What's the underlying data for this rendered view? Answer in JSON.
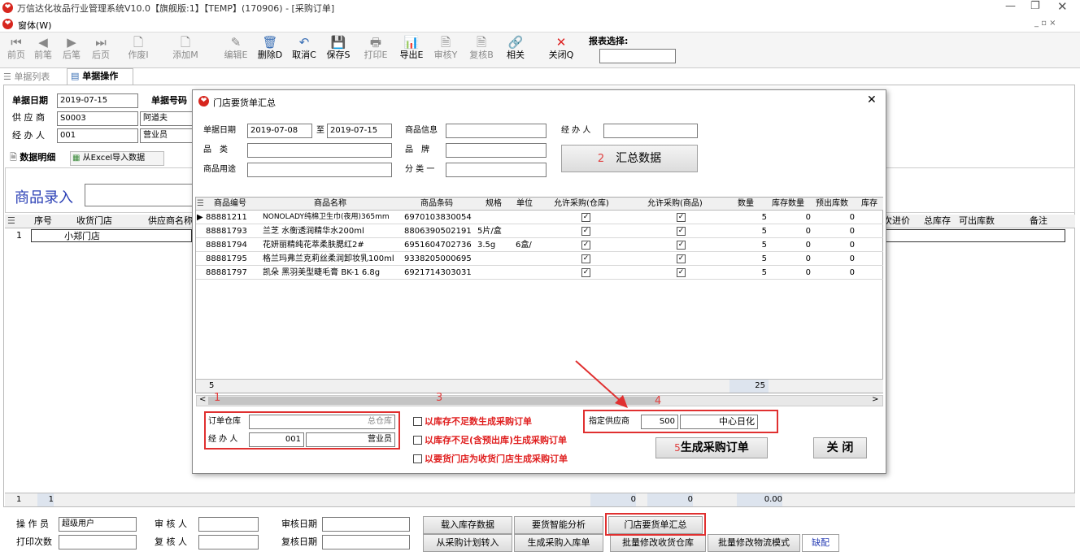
{
  "window": {
    "title": "万信达化妆品行业管理系统V10.0【旗舰版:1】【TEMP】(170906) - [采购订单]",
    "menu": "窗体(W)"
  },
  "toolbar": {
    "items": [
      {
        "label": "前页",
        "icon": "first-icon",
        "enabled": false
      },
      {
        "label": "前笔",
        "icon": "prev-icon",
        "enabled": false
      },
      {
        "label": "后笔",
        "icon": "next-icon",
        "enabled": false
      },
      {
        "label": "后页",
        "icon": "last-icon",
        "enabled": false
      },
      {
        "label": "作废I",
        "icon": "void-icon",
        "enabled": false
      },
      {
        "label": "添加M",
        "icon": "add-icon",
        "enabled": false
      },
      {
        "label": "编辑E",
        "icon": "edit-icon",
        "enabled": false
      },
      {
        "label": "删除D",
        "icon": "delete-icon",
        "enabled": true
      },
      {
        "label": "取消C",
        "icon": "undo-icon",
        "enabled": true
      },
      {
        "label": "保存S",
        "icon": "save-icon",
        "enabled": true
      },
      {
        "label": "打印E",
        "icon": "print-icon",
        "enabled": false
      },
      {
        "label": "导出E",
        "icon": "export-icon",
        "enabled": true
      },
      {
        "label": "审核Y",
        "icon": "audit-icon",
        "enabled": false
      },
      {
        "label": "复核B",
        "icon": "review-icon",
        "enabled": false
      },
      {
        "label": "相关",
        "icon": "link-icon",
        "enabled": true
      },
      {
        "label": "关闭Q",
        "icon": "close-icon",
        "enabled": true
      }
    ],
    "report_label": "报表选择:"
  },
  "tabs": {
    "list": "单据列表",
    "operation": "单据操作"
  },
  "form": {
    "date_label": "单据日期",
    "date": "2019-07-15",
    "number_label": "单据号码",
    "supplier_label": "供 应 商",
    "supplier_code": "S0003",
    "supplier_name": "阿道夫",
    "handler_label": "经 办 人",
    "handler_code": "001",
    "handler_name": "营业员"
  },
  "subtabs": {
    "detail": "数据明细",
    "import": "从Excel导入数据"
  },
  "entry": {
    "label": "商品录入"
  },
  "main_grid": {
    "headers": [
      "序号",
      "收货门店",
      "供应商名称"
    ],
    "right_headers": [
      "次进价",
      "总库存",
      "可出库数",
      "备注"
    ],
    "row": {
      "seq": "1",
      "store": "小郑门店"
    },
    "footer": {
      "seq": "1",
      "count": "1",
      "v1": "0",
      "v2": "0",
      "v3": "0.00"
    }
  },
  "bottom": {
    "operator_label": "操 作 员",
    "operator": "超级用户",
    "auditor_label": "审 核 人",
    "audit_date_label": "审核日期",
    "print_count_label": "打印次数",
    "reviewer_label": "复 核 人",
    "review_date_label": "复核日期",
    "buttons": [
      "载入库存数据",
      "要货智能分析",
      "门店要货单汇总",
      "从采购计划转入",
      "生成采购入库单",
      "批量修改收货仓库",
      "批量修改物流模式"
    ],
    "extra": "缺配"
  },
  "dialog": {
    "title": "门店要货单汇总",
    "filters": {
      "date_label": "单据日期",
      "date_from": "2019-07-08",
      "to": "至",
      "date_to": "2019-07-15",
      "goods_info_label": "商品信息",
      "handler_label": "经 办 人",
      "category_label": "品　类",
      "brand_label": "品　牌",
      "usage_label": "商品用途",
      "class_label": "分 类 一"
    },
    "summarize_btn": "汇总数据",
    "grid": {
      "headers": [
        "商品编号",
        "商品名称",
        "商品条码",
        "规格",
        "单位",
        "允许采购(仓库)",
        "允许采购(商品)",
        "数量",
        "库存数量",
        "预出库数",
        "库存"
      ],
      "rows": [
        {
          "code": "88881211",
          "name": "NONOLADY纯棉卫生巾(夜用)365mm",
          "barcode": "6970103830054",
          "spec": "",
          "unit": "",
          "allow_wh": true,
          "allow_goods": true,
          "qty": "5",
          "stock": "0",
          "pre_out": "0"
        },
        {
          "code": "88881793",
          "name": "兰芝 水衡透润精华水200ml",
          "barcode": "8806390502191",
          "spec": "5片/盒",
          "unit": "",
          "allow_wh": true,
          "allow_goods": true,
          "qty": "5",
          "stock": "0",
          "pre_out": "0"
        },
        {
          "code": "88881794",
          "name": "花妍丽精纯花萃柔肤腮红2#",
          "barcode": "6951604702736",
          "spec": "3.5g",
          "unit": "6盒/",
          "allow_wh": true,
          "allow_goods": true,
          "qty": "5",
          "stock": "0",
          "pre_out": "0"
        },
        {
          "code": "88881795",
          "name": "格兰玛弗兰克莉丝柔润卸妆乳100ml",
          "barcode": "9338205000695",
          "spec": "",
          "unit": "",
          "allow_wh": true,
          "allow_goods": true,
          "qty": "5",
          "stock": "0",
          "pre_out": "0"
        },
        {
          "code": "88881797",
          "name": "凯朵 黑羽美型睫毛膏 BK-1 6.8g",
          "barcode": "6921714303031",
          "spec": "",
          "unit": "",
          "allow_wh": true,
          "allow_goods": true,
          "qty": "5",
          "stock": "0",
          "pre_out": "0"
        }
      ],
      "footer_count": "5",
      "footer_qty": "25"
    },
    "order_wh_label": "订单仓库",
    "order_wh": "总仓库",
    "handler2_label": "经 办 人",
    "handler2_code": "001",
    "handler2_name": "营业员",
    "options": [
      "以库存不足数生成采购订单",
      "以库存不足(含预出库)生成采购订单",
      "以要货门店为收货门店生成采购订单"
    ],
    "supplier_label": "指定供应商",
    "supplier_code": "S00",
    "supplier_name": "中心日化",
    "generate_btn": "生成采购订单",
    "close_btn": "关 闭",
    "annotations": [
      "1",
      "2",
      "3",
      "4",
      "5"
    ]
  }
}
